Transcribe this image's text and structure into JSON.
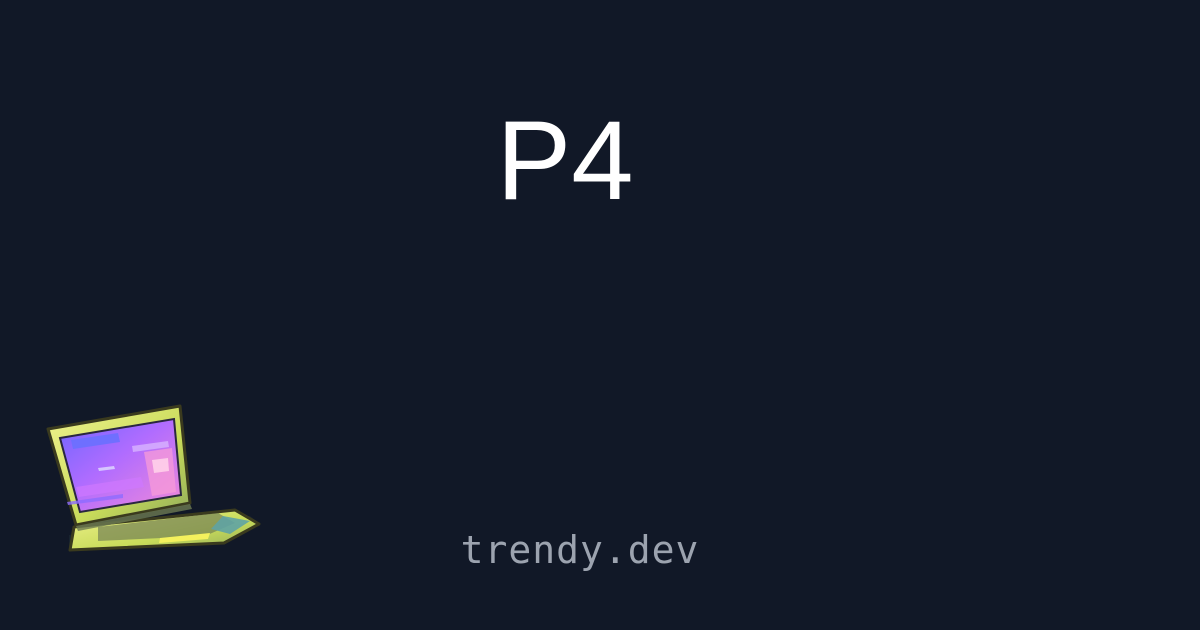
{
  "card": {
    "title": "P4",
    "domain": "trendy.dev"
  },
  "colors": {
    "background": "#111827",
    "title": "#ffffff",
    "domain": "#9ca3af",
    "laptop_body": "#d9f06b",
    "laptop_screen": "#9d66f6"
  },
  "illustration": {
    "icon": "laptop-illustration-icon"
  }
}
